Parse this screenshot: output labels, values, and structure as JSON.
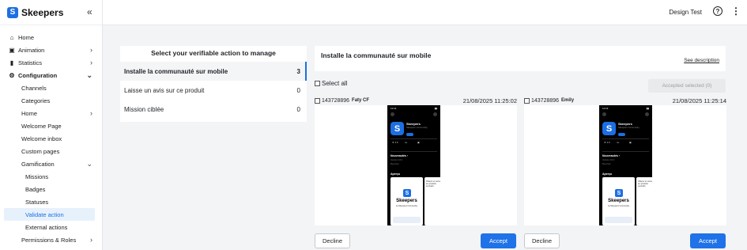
{
  "brand": {
    "name": "Skeepers",
    "logo_letter": "S",
    "collapse_icon": "«"
  },
  "sidebar": {
    "items": [
      {
        "label": "Home",
        "icon": "home-icon",
        "glyph": "⌂"
      },
      {
        "label": "Animation",
        "icon": "calendar-icon",
        "glyph": "▣",
        "chev": "›"
      },
      {
        "label": "Statistics",
        "icon": "bar-chart-icon",
        "glyph": "▮",
        "chev": "›"
      },
      {
        "label": "Configuration",
        "icon": "wrench-icon",
        "glyph": "⚙",
        "chev": "⌄"
      },
      {
        "label": "Channels"
      },
      {
        "label": "Categories"
      },
      {
        "label": "Home",
        "chev": "›"
      },
      {
        "label": "Welcome Page"
      },
      {
        "label": "Welcome inbox"
      },
      {
        "label": "Custom pages"
      },
      {
        "label": "Gamification",
        "chev": "⌄"
      },
      {
        "label": "Missions"
      },
      {
        "label": "Badges"
      },
      {
        "label": "Statuses"
      },
      {
        "label": "Validate action"
      },
      {
        "label": "External actions"
      },
      {
        "label": "Permissions & Roles",
        "chev": "›"
      }
    ]
  },
  "header": {
    "user_name": "Design Test",
    "help_glyph": "?",
    "more_glyph": "⋮"
  },
  "actions": {
    "title": "Select your verifiable action to manage",
    "items": [
      {
        "label": "Installe la communauté sur mobile",
        "count": "3"
      },
      {
        "label": "Laisse un avis sur ce produit",
        "count": "0"
      },
      {
        "label": "Mission ciblée",
        "count": "0"
      }
    ]
  },
  "detail": {
    "title": "Installe la communauté sur mobile",
    "see_description": "See description",
    "select_all": "Select all",
    "accept_selected": "Accepted selected (0)"
  },
  "submissions": [
    {
      "id": "143728896",
      "user": "Faty CF",
      "date": "21/08/2025 11:25:02"
    },
    {
      "id": "143728896",
      "user": "Emily",
      "date": "21/08/2025 11:25:14"
    }
  ],
  "phone": {
    "time": "11:13",
    "app_name": "Skeepers",
    "app_sub": "Skeepers Community",
    "nouveautes": "Nouveautés ›",
    "apercu": "Aperçu",
    "shot_name": "Skeepers",
    "shot_tag": "La Skeepers Community",
    "shot2_text": "Obtenir et suivre les produits exclusifs"
  },
  "buttons": {
    "decline": "Decline",
    "accept": "Accept"
  }
}
